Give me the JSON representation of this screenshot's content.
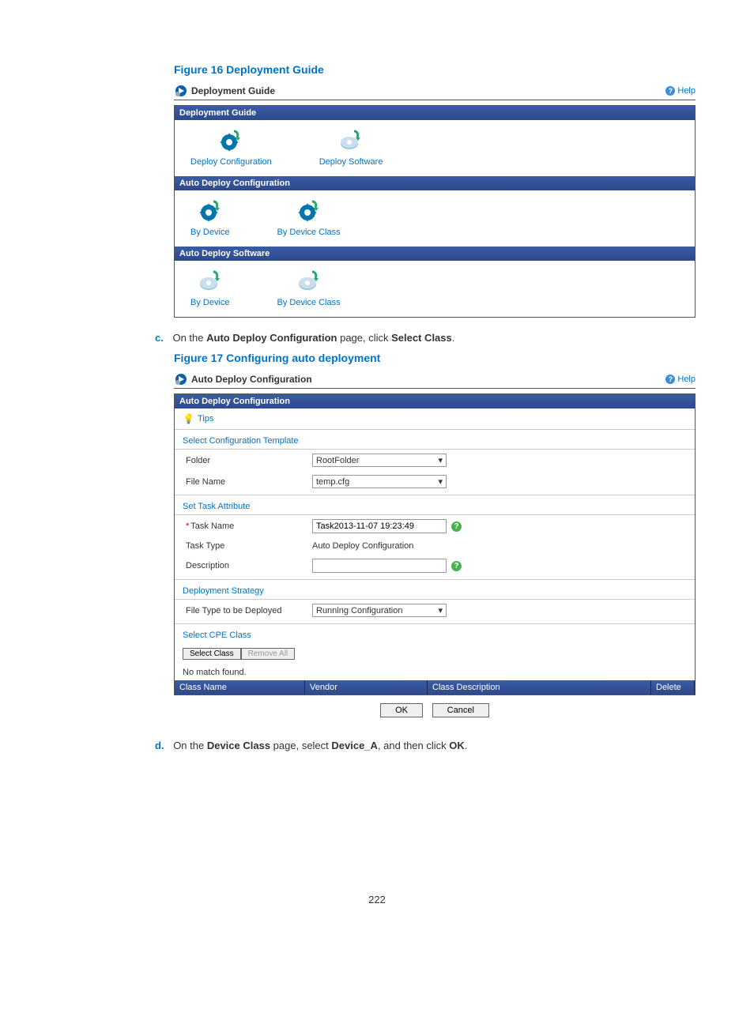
{
  "figure16": {
    "caption": "Figure 16 Deployment Guide",
    "title": "Deployment Guide",
    "help": "Help",
    "sections": [
      {
        "header": "Deployment Guide",
        "items": [
          "Deploy Configuration",
          "Deploy Software"
        ],
        "icon_type": "mixed"
      },
      {
        "header": "Auto Deploy Configuration",
        "items": [
          "By Device",
          "By Device Class"
        ],
        "icon_type": "cfg"
      },
      {
        "header": "Auto Deploy Software",
        "items": [
          "By Device",
          "By Device Class"
        ],
        "icon_type": "sw"
      }
    ]
  },
  "step_c": {
    "letter": "c.",
    "text_prefix": "On the ",
    "bold1": "Auto Deploy Configuration",
    "text_mid": " page, click ",
    "bold2": "Select Class",
    "text_end": "."
  },
  "figure17": {
    "caption": "Figure 17 Configuring auto deployment",
    "title": "Auto Deploy Configuration",
    "help": "Help",
    "section_header": "Auto Deploy Configuration",
    "tips": "Tips",
    "groups": {
      "sct": {
        "title": "Select Configuration Template",
        "folder_label": "Folder",
        "folder_value": "RootFolder",
        "filename_label": "File Name",
        "filename_value": "temp.cfg"
      },
      "sta": {
        "title": "Set Task Attribute",
        "taskname_label": "Task Name",
        "taskname_value": "Task2013-11-07 19:23:49",
        "tasktype_label": "Task Type",
        "tasktype_value": "Auto Deploy Configuration",
        "desc_label": "Description",
        "desc_value": ""
      },
      "ds": {
        "title": "Deployment Strategy",
        "filetype_label": "File Type to be Deployed",
        "filetype_value": "Running Configuration"
      },
      "scc": {
        "title": "Select CPE Class",
        "select_class_btn": "Select Class",
        "remove_all_btn": "Remove All",
        "nomatch": "No match found."
      }
    },
    "table": {
      "classname": "Class Name",
      "vendor": "Vendor",
      "classdesc": "Class Description",
      "delete": "Delete"
    },
    "ok": "OK",
    "cancel": "Cancel"
  },
  "step_d": {
    "letter": "d.",
    "text_prefix": "On the ",
    "bold1": "Device Class",
    "text_mid": " page, select ",
    "bold2": "Device_A",
    "text_mid2": ", and then click ",
    "bold3": "OK",
    "text_end": "."
  },
  "page_number": "222"
}
